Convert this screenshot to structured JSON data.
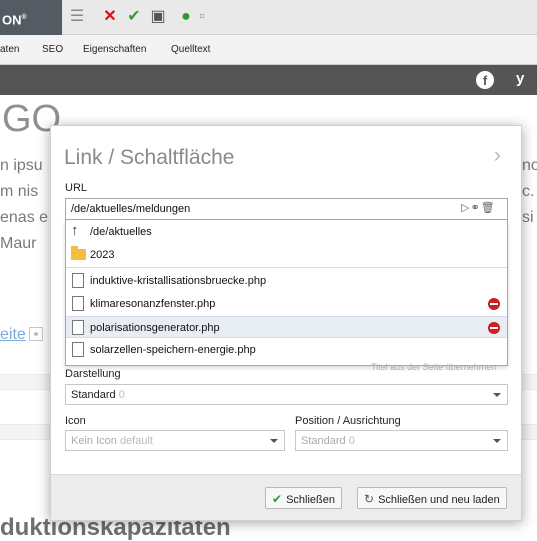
{
  "toolbar": {
    "brand": "ON",
    "brand_mark": "®",
    "icons": [
      "list-icon",
      "close-icon",
      "check-save-icon",
      "save-icon",
      "check-circle-icon",
      "page-icon"
    ],
    "menu": [
      "aten",
      "SEO",
      "Eigenschaften",
      "Quelltext"
    ]
  },
  "social": {
    "facebook": "f",
    "twitter": "y"
  },
  "background": {
    "title": "GO",
    "lines_left": [
      "n ipsu",
      "m nis",
      "enas e",
      " Maur"
    ],
    "lines_right": [
      "no",
      "c.",
      "si"
    ],
    "link": "eite",
    "heading": "duktionskapazitäten"
  },
  "dialog": {
    "title": "Link / Schaltfläche",
    "url_label": "URL",
    "url_value": "/de/aktuelles/meldungen",
    "dropdown": {
      "parent": "/de/aktuelles",
      "folder": "2023",
      "files": [
        {
          "name": "induktive-kristallisationsbruecke.php",
          "deletable": false,
          "selected": false
        },
        {
          "name": "klimaresonanzfenster.php",
          "deletable": true,
          "selected": false
        },
        {
          "name": "polarisationsgenerator.php",
          "deletable": true,
          "selected": true
        },
        {
          "name": "solarzellen-speichern-energie.php",
          "deletable": false,
          "selected": false
        }
      ]
    },
    "title_hint": "Titel aus der Seite übernehmen",
    "display_label": "Darstellung",
    "display_value": "Standard",
    "display_suffix": "0",
    "icon_label": "Icon",
    "icon_value": "Kein Icon",
    "icon_suffix": "default",
    "position_label": "Position / Ausrichtung",
    "position_value": "Standard",
    "position_suffix": "0",
    "btn_close": "Schließen",
    "btn_close_reload": "Schließen und neu laden"
  }
}
